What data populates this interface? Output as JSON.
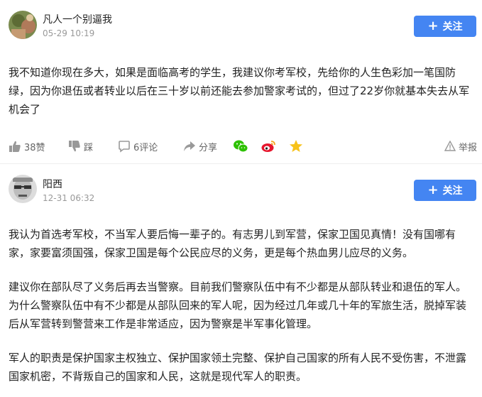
{
  "posts": [
    {
      "username": "凡人一个别逼我",
      "time": "05-29 10:19",
      "follow_label": "关注",
      "paragraphs": [
        "我不知道你现在多大，如果是面临高考的学生，我建议你考军校，先给你的人生色彩加一笔国防绿，因为你退伍或者转业以后在三十岁以前还能去参加警家考试的，但过了22岁你就基本失去从军机会了"
      ],
      "actions": {
        "like_label": "38赞",
        "dislike_label": "踩",
        "comment_label": "6评论",
        "share_label": "分享",
        "report_label": "举报"
      }
    },
    {
      "username": "阳西",
      "time": "12-31 06:32",
      "follow_label": "关注",
      "paragraphs": [
        "我认为首选考军校，不当军人要后悔一辈子的。有志男儿到军营，保家卫国见真情！没有国哪有家，家要富须国强，保家卫国是每个公民应尽的义务，更是每个热血男儿应尽的义务。",
        "建议你在部队尽了义务后再去当警察。目前我们警察队伍中有不少都是从部队转业和退伍的军人。为什么警察队伍中有不少都是从部队回来的军人呢，因为经过几年或几十年的军旅生活，脱掉军装后从军营转到警营来工作是非常适应，因为警察是半军事化管理。",
        "军人的职责是保护国家主权独立、保护国家领土完整、保护自己国家的所有人民不受伤害，不泄露国家机密，不背叛自己的国家和人民，这就是现代军人的职责。"
      ]
    }
  ]
}
